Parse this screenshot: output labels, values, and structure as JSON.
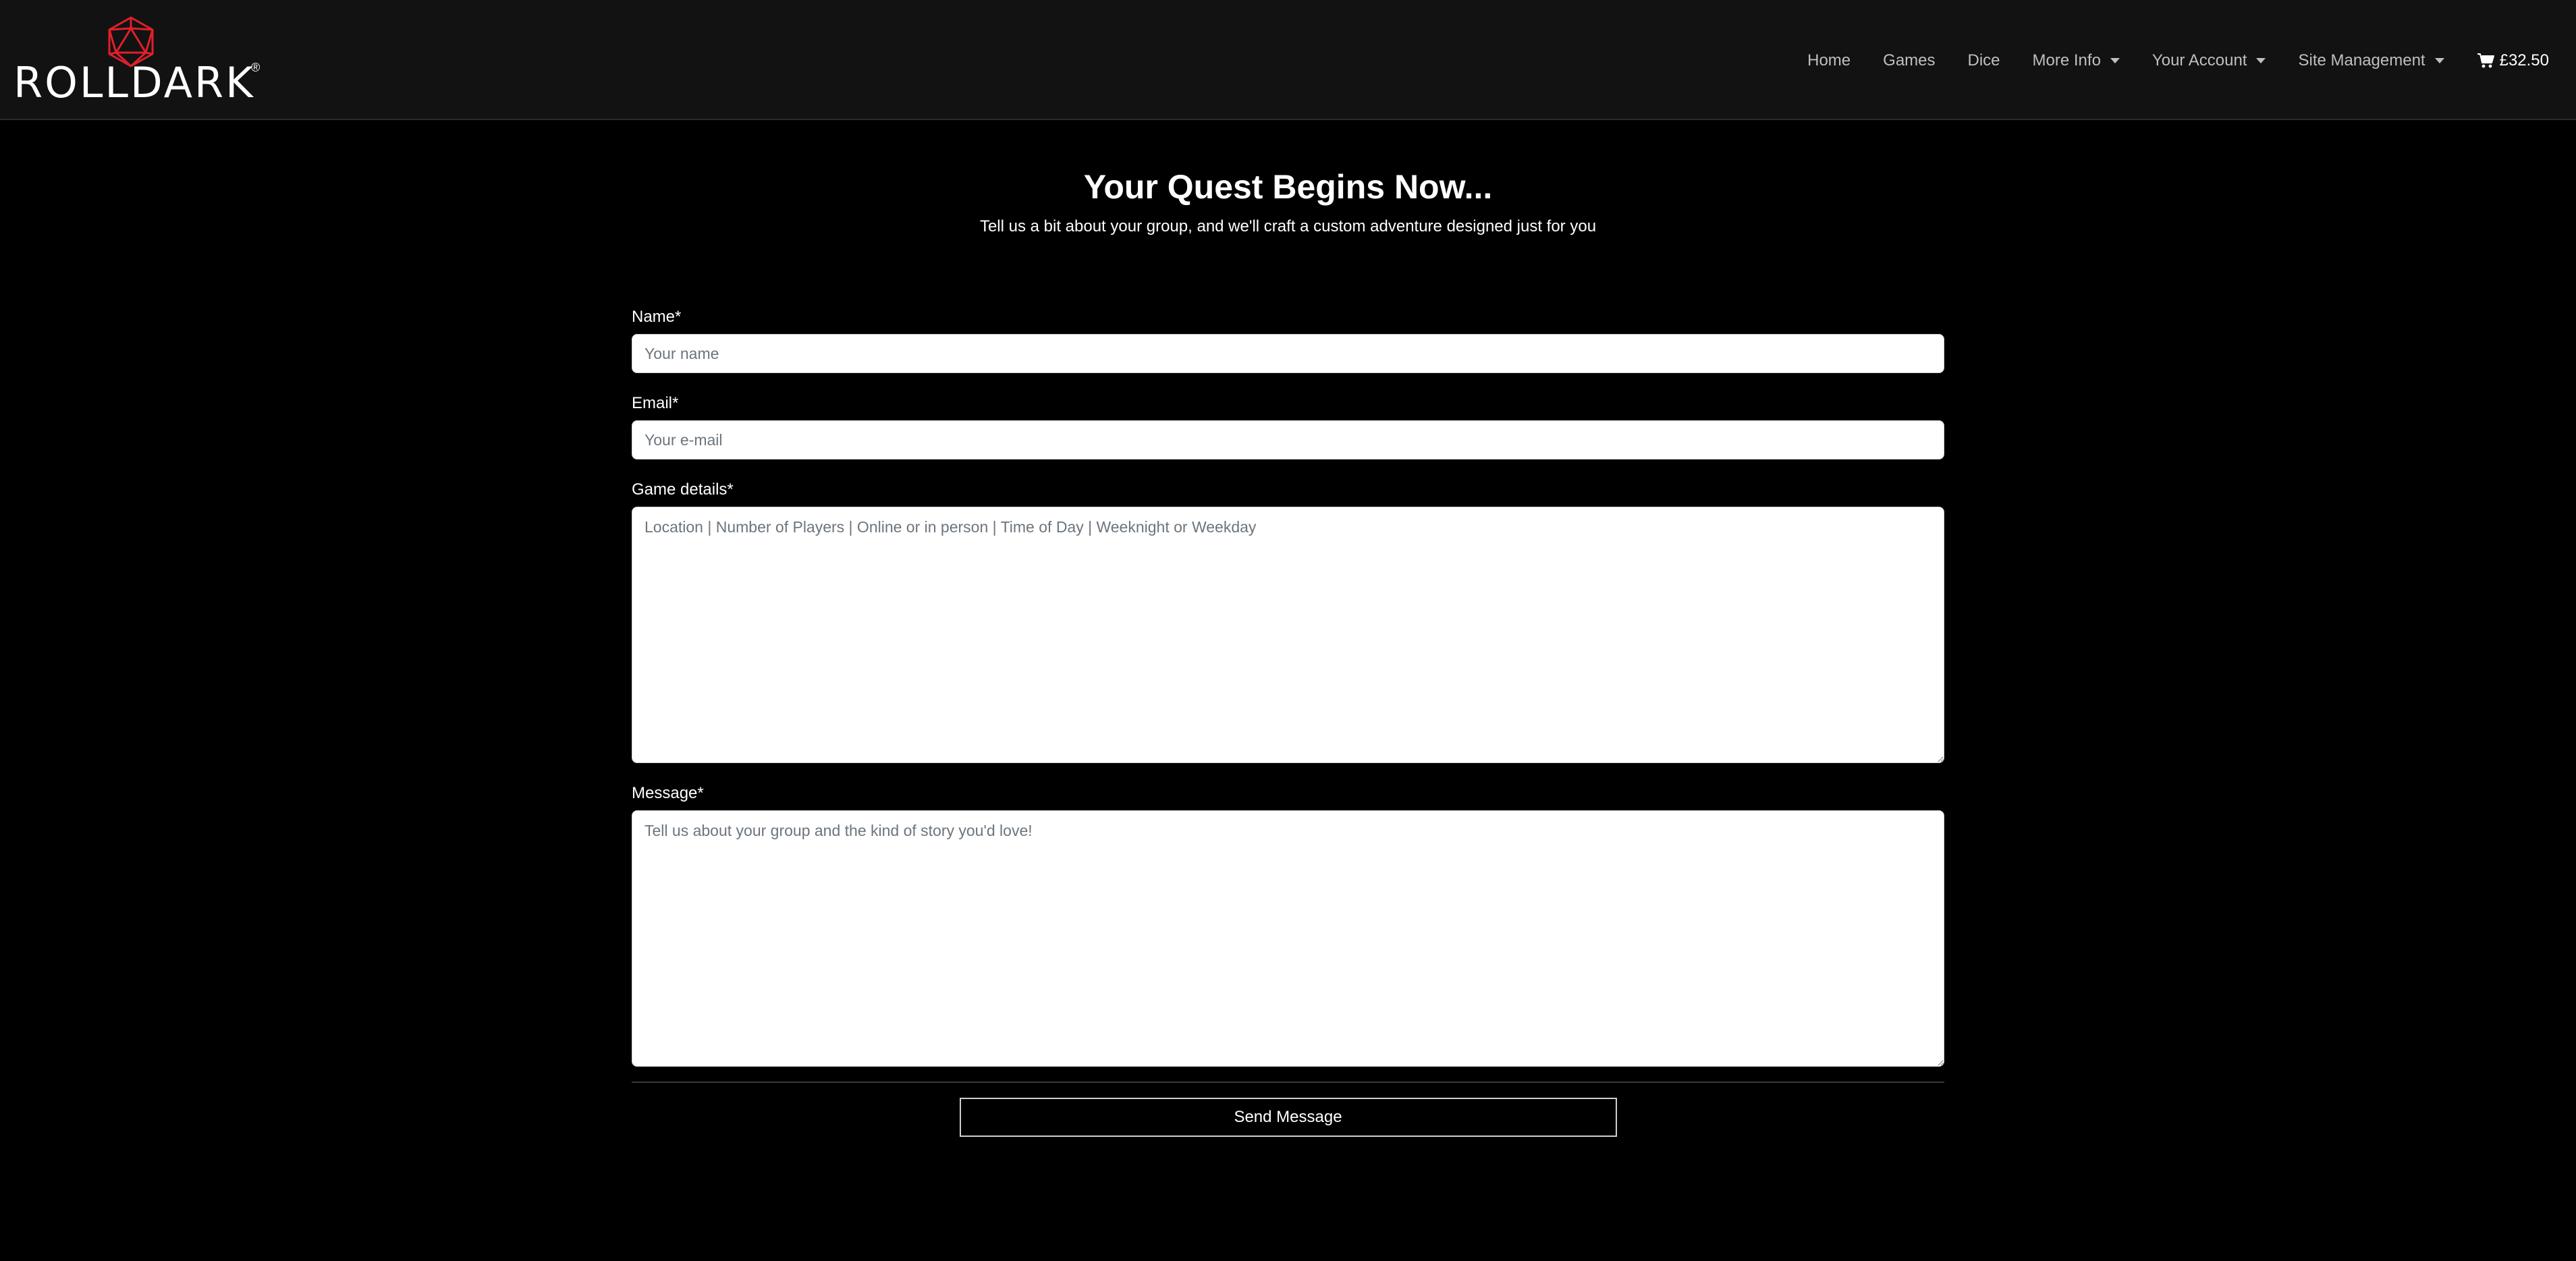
{
  "brand": {
    "name": "ROLLDARK",
    "registered_mark": "®",
    "logo_icon": "d20-die-icon",
    "logo_color": "#e0202a"
  },
  "nav": {
    "home": "Home",
    "games": "Games",
    "dice": "Dice",
    "more_info": "More Info",
    "your_account": "Your Account",
    "site_management": "Site Management",
    "cart_total": "£32.50",
    "cart_icon": "shopping-cart-icon"
  },
  "hero": {
    "title": "Your Quest Begins Now...",
    "subtitle": "Tell us a bit about your group, and we'll craft a custom adventure designed just for you"
  },
  "form": {
    "name_label": "Name*",
    "name_placeholder": "Your name",
    "email_label": "Email*",
    "email_placeholder": "Your e-mail",
    "game_details_label": "Game details*",
    "game_details_placeholder": "Location | Number of Players | Online or in person | Time of Day | Weeknight or Weekday",
    "message_label": "Message*",
    "message_placeholder": "Tell us about your group and the kind of story you'd love!",
    "submit_label": "Send Message"
  },
  "colors": {
    "background": "#000000",
    "navbar": "#121212",
    "accent": "#e0202a"
  }
}
